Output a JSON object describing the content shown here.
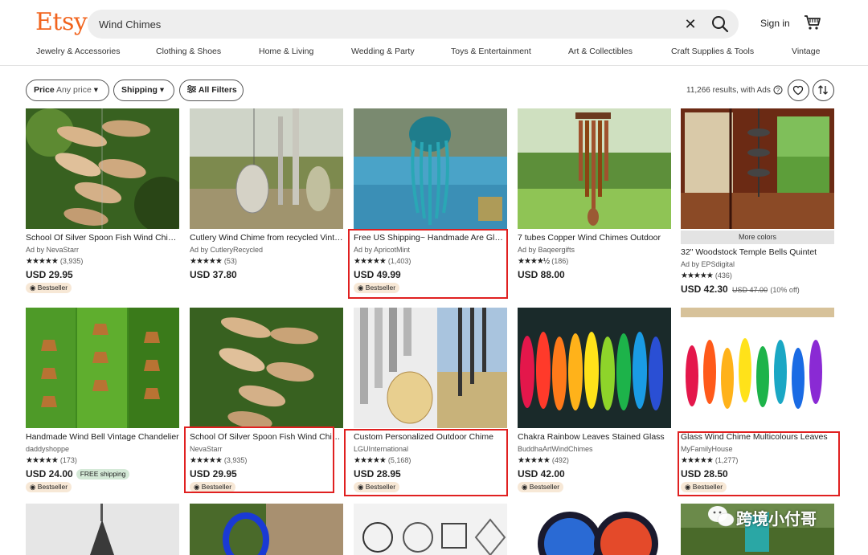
{
  "header": {
    "logo": "Etsy",
    "search_value": "Wind Chimes",
    "clear_icon": "close-icon",
    "search_icon": "search-icon",
    "signin": "Sign in",
    "cart_icon": "cart-icon"
  },
  "categories": [
    "Jewelry & Accessories",
    "Clothing & Shoes",
    "Home & Living",
    "Wedding & Party",
    "Toys & Entertainment",
    "Art & Collectibles",
    "Craft Supplies & Tools",
    "Vintage"
  ],
  "filters": {
    "price_label": "Price",
    "price_value": "Any price",
    "shipping_label": "Shipping",
    "all_filters": "All Filters",
    "results": "11,266 results, with Ads"
  },
  "products": [
    {
      "title": "School Of Silver Spoon Fish Wind Chime",
      "seller": "Ad by NevaStarr",
      "stars": "★★★★★",
      "reviews": "(3,935)",
      "price": "USD 29.95",
      "badge": "Bestseller"
    },
    {
      "title": "Cutlery Wind Chime from recycled Vintage Silverware",
      "seller": "Ad by CutleryRecycled",
      "stars": "★★★★★",
      "reviews": "(53)",
      "price": "USD 37.80"
    },
    {
      "title": "Free US Shipping~ Handmade Are Glass Jellyfish",
      "seller": "Ad by ApricotMint",
      "stars": "★★★★★",
      "reviews": "(1,403)",
      "price": "USD 49.99",
      "badge": "Bestseller"
    },
    {
      "title": "7 tubes Copper Wind Chimes Outdoor",
      "seller": "Ad by Baqeergifts",
      "stars": "★★★★½",
      "reviews": "(186)",
      "price": "USD 88.00"
    },
    {
      "title": "32\" Woodstock Temple Bells Quintet",
      "seller": "Ad by EPSdigital",
      "stars": "★★★★★",
      "reviews": "(436)",
      "price": "USD 42.30",
      "original_price": "USD 47.00",
      "discount": "(10% off)",
      "more_colors": "More colors"
    },
    {
      "title": "Handmade Wind Bell Vintage Chandelier",
      "seller": "daddyshoppe",
      "stars": "★★★★★",
      "reviews": "(173)",
      "price": "USD 24.00",
      "free_shipping": "FREE shipping",
      "badge": "Bestseller"
    },
    {
      "title": "School Of Silver Spoon Fish Wind Chime",
      "seller": "NevaStarr",
      "stars": "★★★★★",
      "reviews": "(3,935)",
      "price": "USD 29.95",
      "badge": "Bestseller"
    },
    {
      "title": "Custom Personalized Outdoor Chime",
      "seller": "LGUInternational",
      "stars": "★★★★★",
      "reviews": "(5,168)",
      "price": "USD 28.95",
      "badge": "Bestseller"
    },
    {
      "title": "Chakra Rainbow Leaves Stained Glass",
      "seller": "BuddhaArtWindChimes",
      "stars": "★★★★★",
      "reviews": "(492)",
      "price": "USD 42.00",
      "badge": "Bestseller"
    },
    {
      "title": "Glass Wind Chime Multicolours Leaves",
      "seller": "MyFamilyHouse",
      "stars": "★★★★★",
      "reviews": "(1,277)",
      "price": "USD 28.50",
      "badge": "Bestseller"
    }
  ],
  "watermark": "跨境小付哥",
  "colors": {
    "brand": "#f1641e",
    "highlight": "#e02020",
    "bestseller_bg": "#f7e8d6",
    "free_shipping_bg": "#d4e9d7"
  }
}
